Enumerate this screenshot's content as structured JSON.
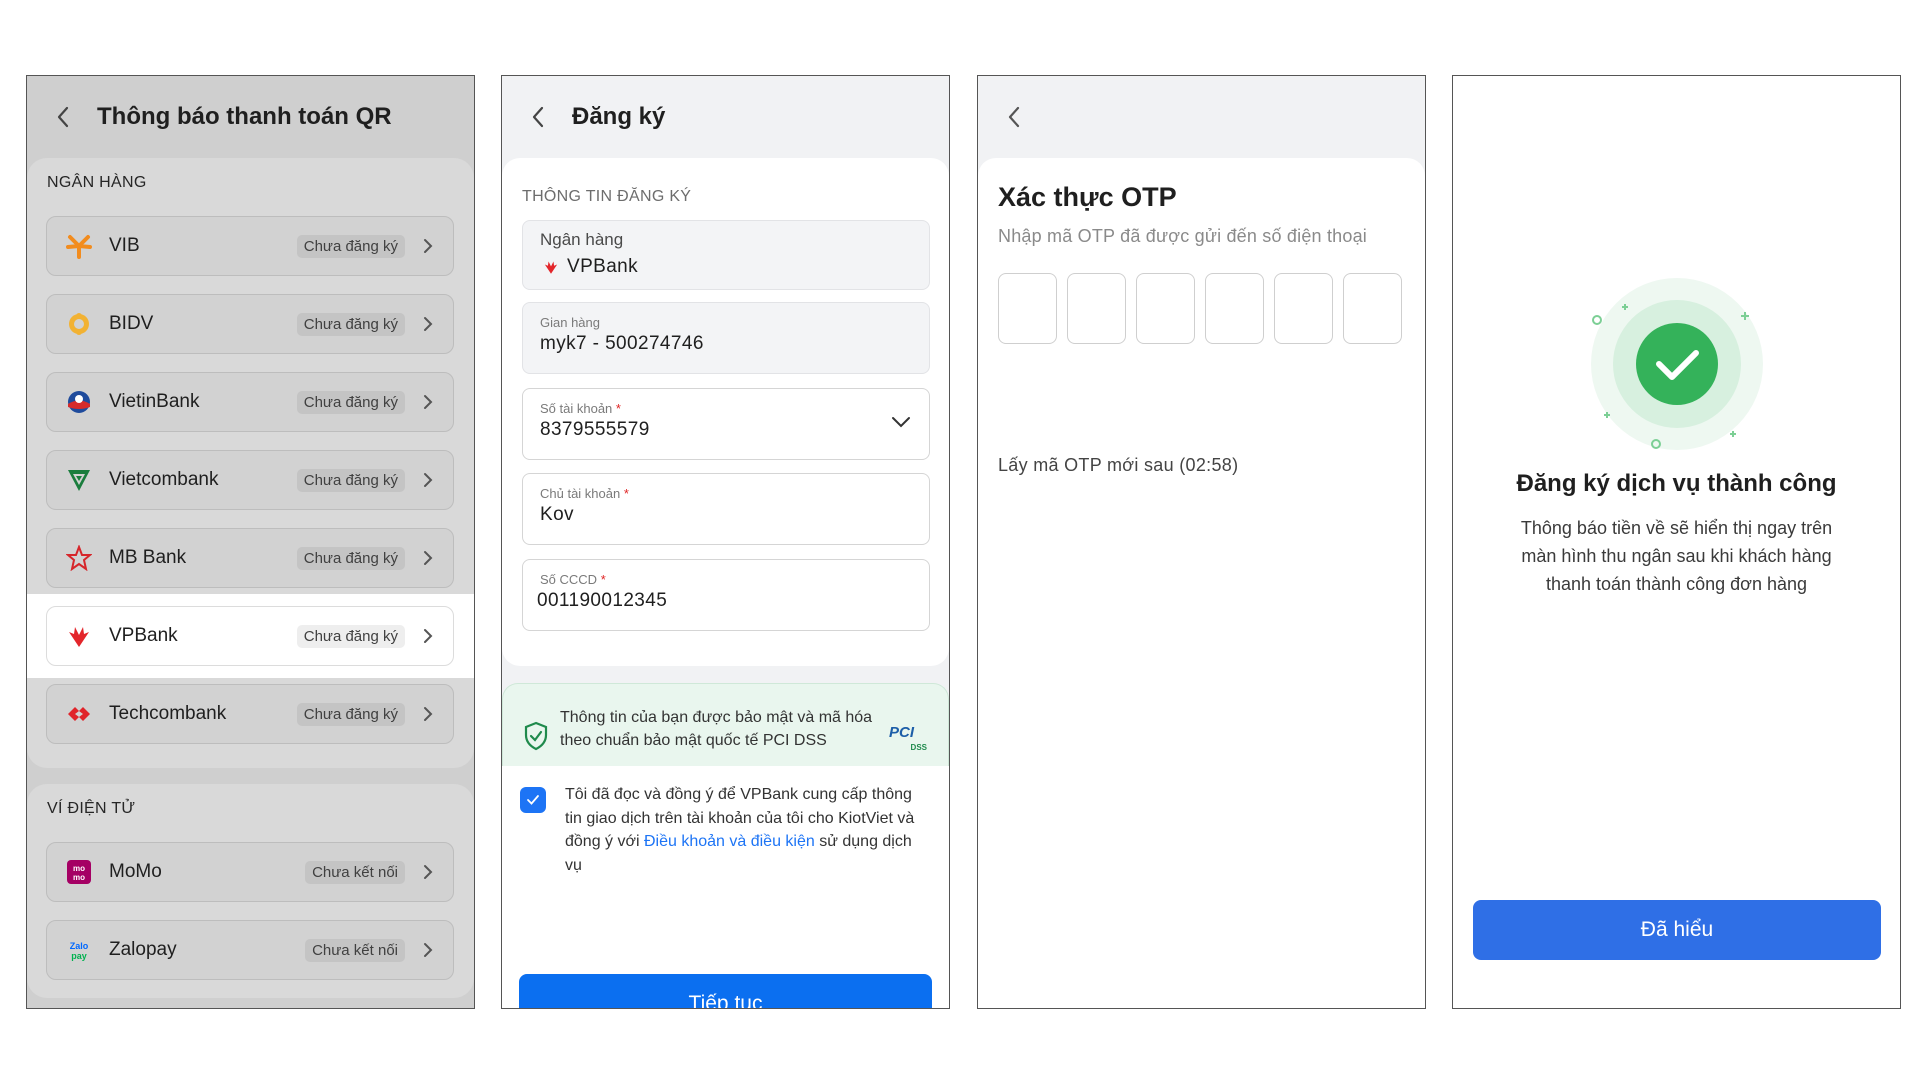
{
  "screen1": {
    "title": "Thông báo thanh toán QR",
    "banks_section": "NGÂN HÀNG",
    "banks": [
      {
        "name": "VIB",
        "status": "Chưa đăng ký",
        "logo": "vib-logo-icon"
      },
      {
        "name": "BIDV",
        "status": "Chưa đăng ký",
        "logo": "bidv-logo-icon"
      },
      {
        "name": "VietinBank",
        "status": "Chưa đăng ký",
        "logo": "vietinbank-logo-icon"
      },
      {
        "name": "Vietcombank",
        "status": "Chưa đăng ký",
        "logo": "vietcombank-logo-icon"
      },
      {
        "name": "MB Bank",
        "status": "Chưa đăng ký",
        "logo": "mbbank-logo-icon"
      },
      {
        "name": "VPBank",
        "status": "Chưa đăng ký",
        "logo": "vpbank-logo-icon"
      },
      {
        "name": "Techcombank",
        "status": "Chưa đăng ký",
        "logo": "techcombank-logo-icon"
      }
    ],
    "wallets_section": "VÍ ĐIỆN TỬ",
    "wallets": [
      {
        "name": "MoMo",
        "status": "Chưa kết nối",
        "logo": "momo-logo-icon"
      },
      {
        "name": "Zalopay",
        "status": "Chưa kết nối",
        "logo": "zalopay-logo-icon"
      }
    ]
  },
  "screen2": {
    "title": "Đăng ký",
    "section": "THÔNG TIN ĐĂNG KÝ",
    "bank_label": "Ngân hàng",
    "bank_value": "VPBank",
    "store_label": "Gian hàng",
    "store_value": "myk7 - 500274746",
    "account_label": "Số tài khoản",
    "account_value": "8379555579",
    "holder_label": "Chủ tài khoản",
    "holder_value": "Kov",
    "id_label": "Số CCCD",
    "id_value": "001190012345",
    "required_mark": "*",
    "security_text": "Thông tin của bạn được bảo mật và mã hóa theo chuẩn bảo mật quốc tế PCI DSS",
    "pci_badge": "PCI",
    "pci_sub": "DSS",
    "consent_text_1": "Tôi đã đọc và đồng ý để VPBank cung cấp thông tin giao dịch trên tài khoản của tôi cho KiotViet và đồng ý với ",
    "consent_link": "Điều khoản và điều kiện",
    "consent_text_2": " sử dụng dịch vụ",
    "continue_button": "Tiếp tục"
  },
  "screen3": {
    "title": "Xác thực OTP",
    "subtitle": "Nhập mã OTP đã được gửi đến số điện thoại",
    "resend": "Lấy mã OTP mới sau (02:58)"
  },
  "screen4": {
    "title": "Đăng ký dịch vụ thành công",
    "description": "Thông báo tiền về sẽ hiển thị ngay trên màn hình thu ngân sau khi khách hàng thanh toán thành công đơn hàng",
    "button": "Đã hiểu"
  },
  "colors": {
    "primary": "#0b6ff0",
    "success": "#34b25a",
    "vpbank_red": "#e3262b",
    "overlay_gray": "#cfcfcf"
  }
}
